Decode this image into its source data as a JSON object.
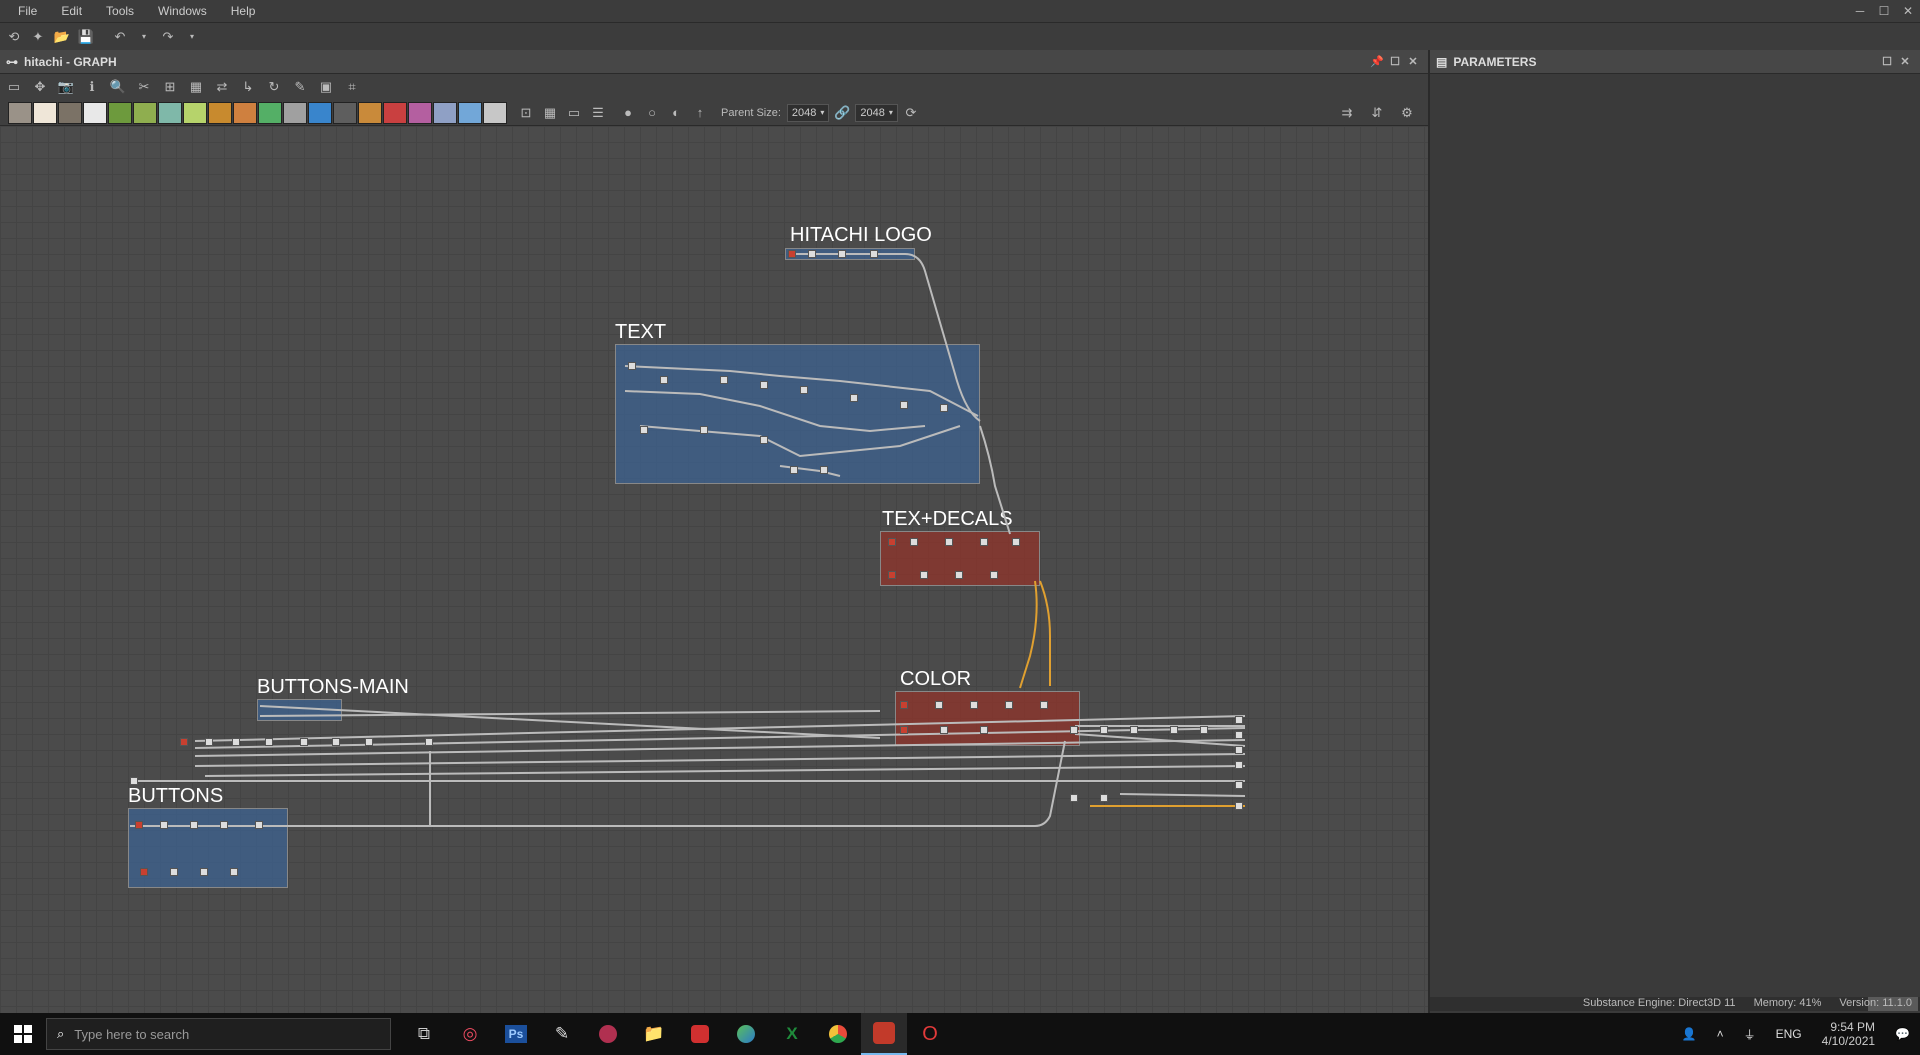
{
  "menu": {
    "file": "File",
    "edit": "Edit",
    "tools": "Tools",
    "windows": "Windows",
    "help": "Help"
  },
  "graph_panel": {
    "title": "hitachi - GRAPH",
    "parent_size_label": "Parent Size:",
    "parent_size_value": "2048",
    "size2_value": "2048"
  },
  "param_panel": {
    "title": "PARAMETERS"
  },
  "frames": {
    "hitachi_logo": "HITACHI LOGO",
    "text": "TEXT",
    "tex_decals": "TEX+DECALS",
    "color": "COLOR",
    "buttons_main": "BUTTONS-MAIN",
    "buttons": "BUTTONS"
  },
  "status": {
    "engine": "Substance Engine: Direct3D 11",
    "memory": "Memory: 41%",
    "version": "Version: 11.1.0"
  },
  "taskbar": {
    "search_placeholder": "Type here to search",
    "lang": "ENG",
    "time": "9:54 PM",
    "date": "4/10/2021"
  },
  "node_swatches": [
    "#9a9288",
    "#efe6d8",
    "#7b7266",
    "#e8e8e8",
    "#6d9a3d",
    "#8fae4f",
    "#7fb8a9",
    "#b6d36b",
    "#c88a2e",
    "#cf803f",
    "#54af66",
    "#a0a0a0",
    "#3985cc",
    "#5e5e5e",
    "#c98a3a",
    "#c94040",
    "#b45fa0",
    "#8fa0c5",
    "#72a7d8",
    "#c7c7c7"
  ]
}
